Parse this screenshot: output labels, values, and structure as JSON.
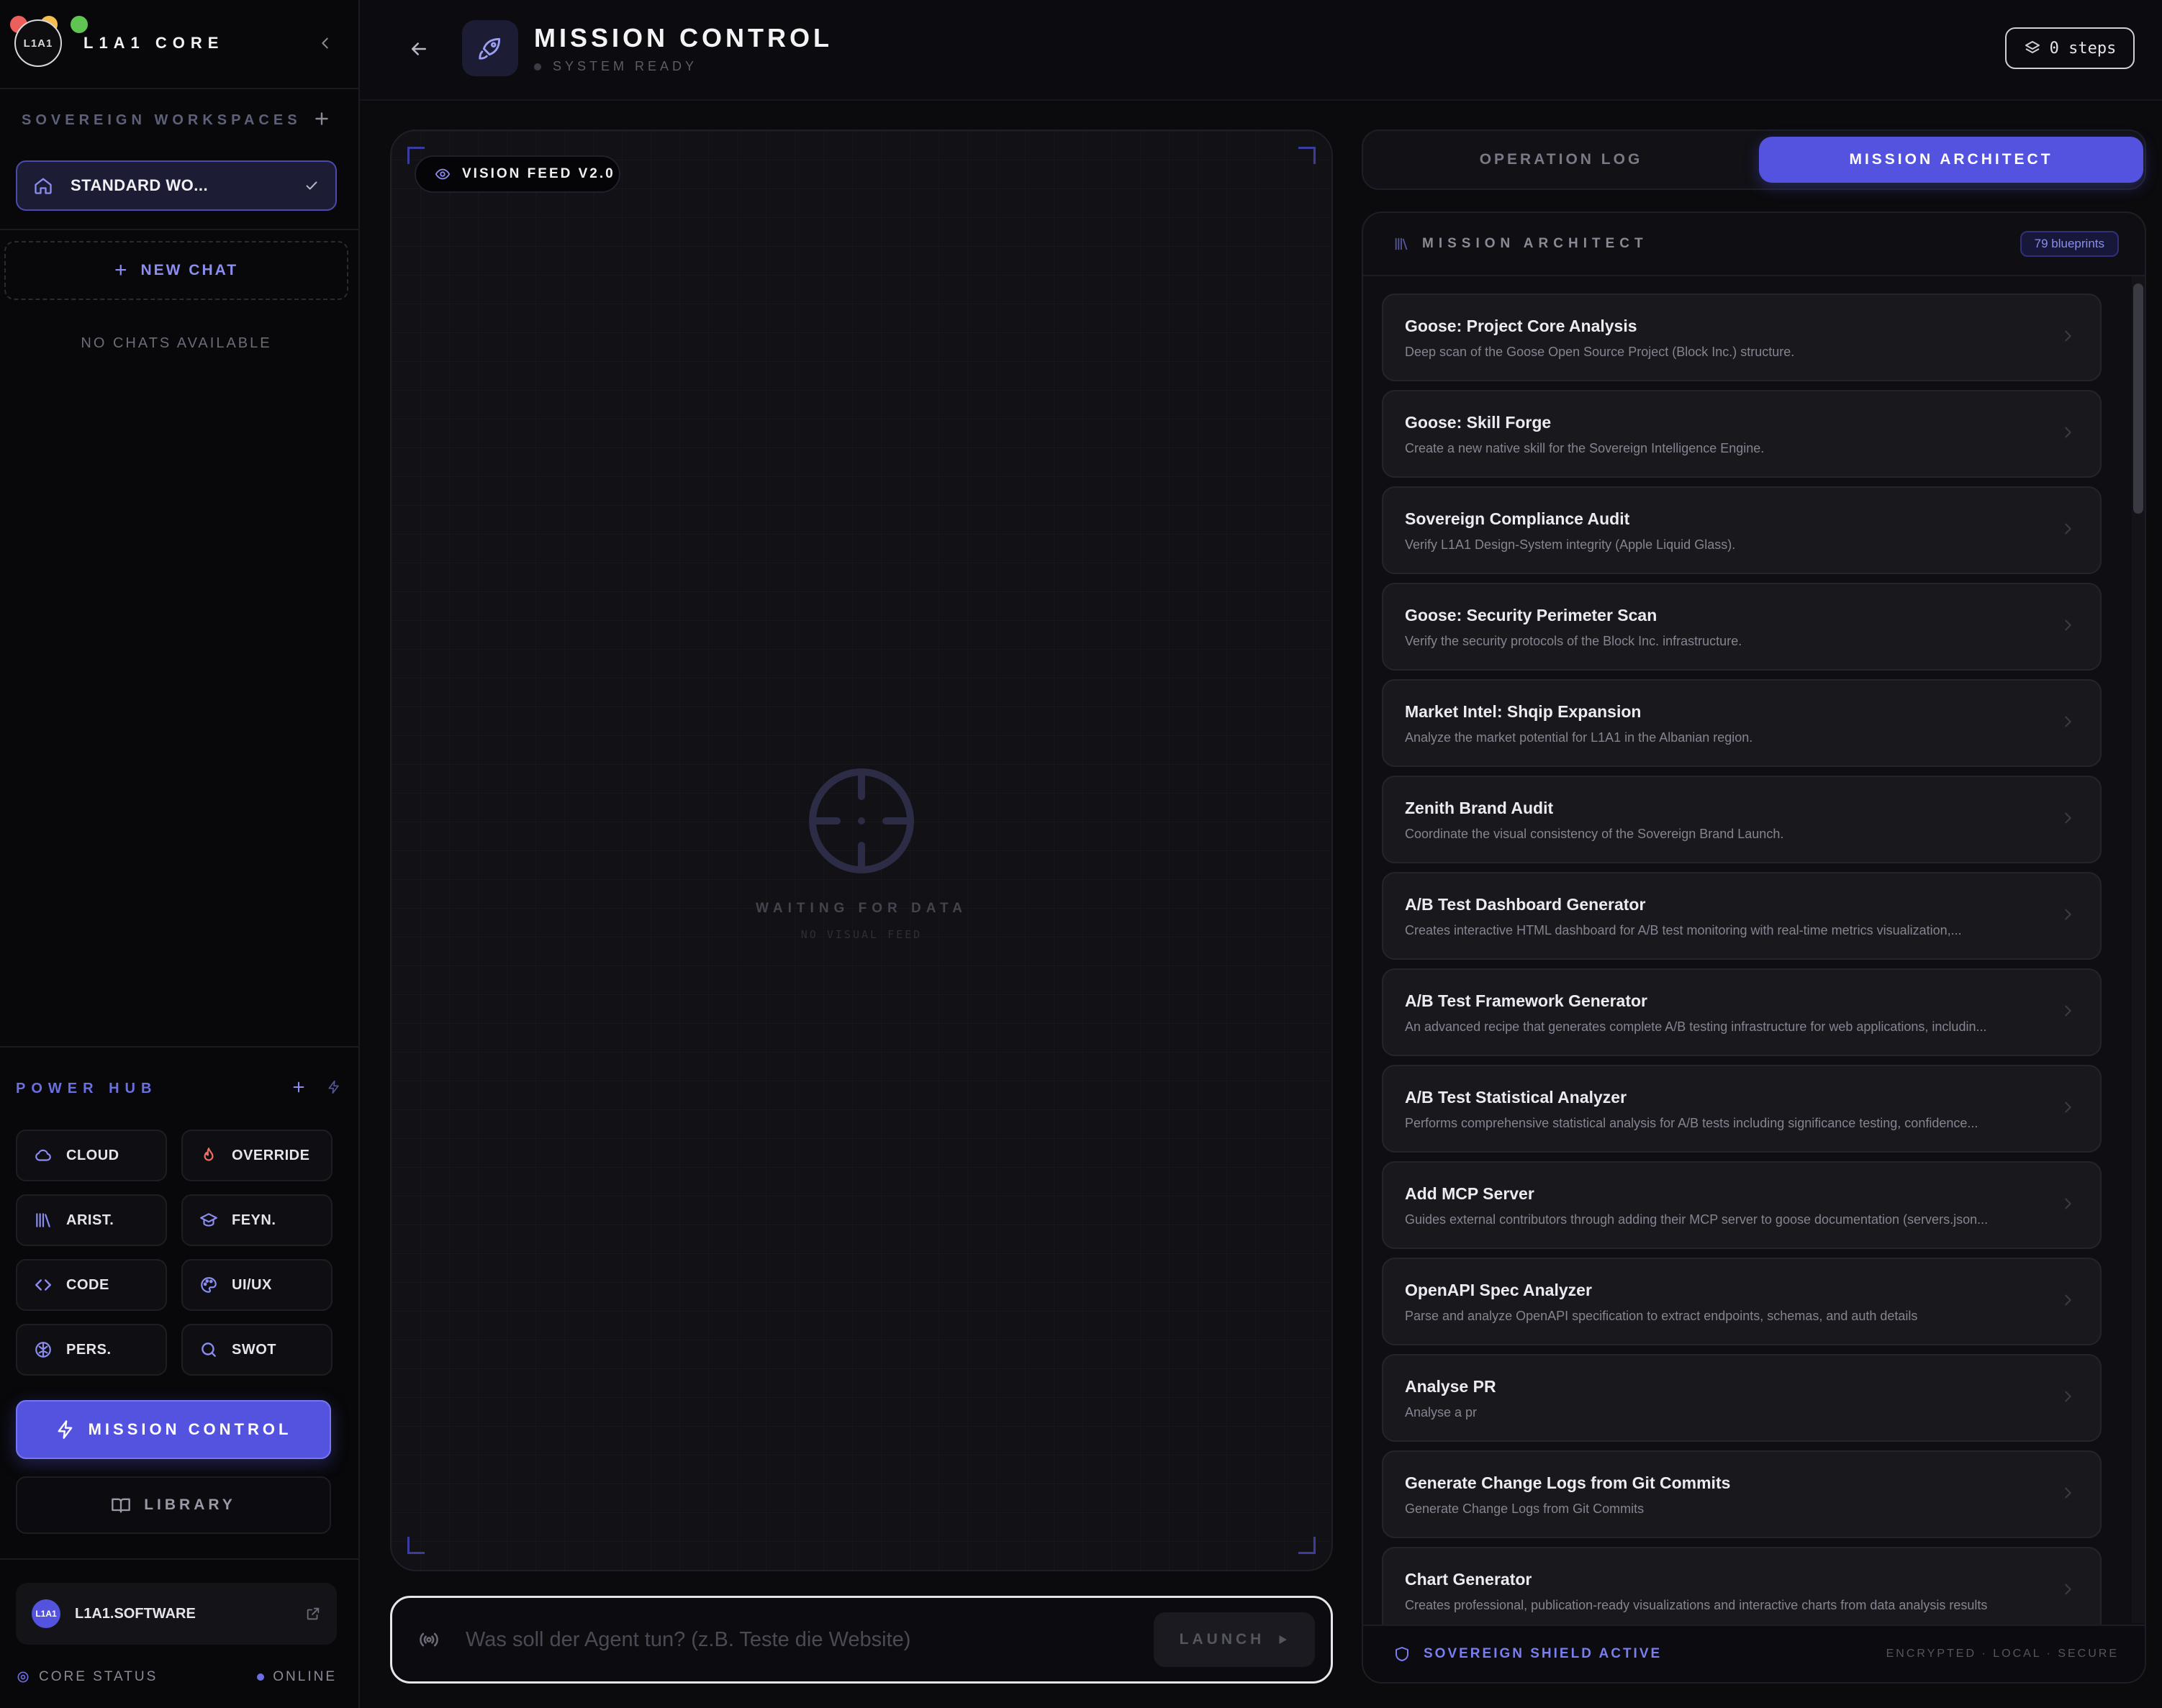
{
  "window": {
    "traffic_lights": [
      "#ec5f5a",
      "#f4be4f",
      "#5fc452"
    ]
  },
  "sidebar": {
    "brand": {
      "logo_text": "L1A1",
      "name": "L1A1 CORE"
    },
    "workspaces": {
      "title": "SOVEREIGN WORKSPACES",
      "active": "STANDARD WO..."
    },
    "new_chat": "NEW CHAT",
    "no_chats": "NO CHATS AVAILABLE",
    "power_hub": {
      "title": "POWER HUB",
      "items": [
        {
          "label": "CLOUD",
          "icon": "cloud-icon"
        },
        {
          "label": "OVERRIDE",
          "icon": "flame-icon"
        },
        {
          "label": "ARIST.",
          "icon": "library-icon"
        },
        {
          "label": "FEYN.",
          "icon": "graduation-cap-icon"
        },
        {
          "label": "CODE",
          "icon": "code-icon"
        },
        {
          "label": "UI/UX",
          "icon": "palette-icon"
        },
        {
          "label": "PERS.",
          "icon": "brain-icon"
        },
        {
          "label": "SWOT",
          "icon": "search-icon"
        }
      ]
    },
    "mission_control": "MISSION CONTROL",
    "library": "LIBRARY",
    "account": {
      "logo_text": "L1A1",
      "name": "L1A1.SOFTWARE"
    },
    "core_status": {
      "label": "CORE STATUS",
      "value": "ONLINE"
    }
  },
  "header": {
    "title": "MISSION CONTROL",
    "subtitle": "SYSTEM READY",
    "steps": "0 steps"
  },
  "vision": {
    "badge": "VISION FEED V2.0",
    "waiting": "WAITING FOR DATA",
    "no_feed": "NO VISUAL FEED"
  },
  "command": {
    "placeholder": "Was soll der Agent tun? (z.B. Teste die Website)",
    "launch": "LAUNCH"
  },
  "tabs": {
    "log": "OPERATION LOG",
    "architect": "MISSION ARCHITECT"
  },
  "architect": {
    "title": "MISSION ARCHITECT",
    "count": "79 blueprints",
    "blueprints": [
      {
        "title": "Goose: Project Core Analysis",
        "desc": "Deep scan of the Goose Open Source Project (Block Inc.) structure."
      },
      {
        "title": "Goose: Skill Forge",
        "desc": "Create a new native skill for the Sovereign Intelligence Engine."
      },
      {
        "title": "Sovereign Compliance Audit",
        "desc": "Verify L1A1 Design-System integrity (Apple Liquid Glass)."
      },
      {
        "title": "Goose: Security Perimeter Scan",
        "desc": "Verify the security protocols of the Block Inc. infrastructure."
      },
      {
        "title": "Market Intel: Shqip Expansion",
        "desc": "Analyze the market potential for L1A1 in the Albanian region."
      },
      {
        "title": "Zenith Brand Audit",
        "desc": "Coordinate the visual consistency of the Sovereign Brand Launch."
      },
      {
        "title": "A/B Test Dashboard Generator",
        "desc": "Creates interactive HTML dashboard for A/B test monitoring with real-time metrics visualization,..."
      },
      {
        "title": "A/B Test Framework Generator",
        "desc": "An advanced recipe that generates complete A/B testing infrastructure for web applications, includin..."
      },
      {
        "title": "A/B Test Statistical Analyzer",
        "desc": "Performs comprehensive statistical analysis for A/B tests including significance testing, confidence..."
      },
      {
        "title": "Add MCP Server",
        "desc": "Guides external contributors through adding their MCP server to goose documentation (servers.json..."
      },
      {
        "title": "OpenAPI Spec Analyzer",
        "desc": "Parse and analyze OpenAPI specification to extract endpoints, schemas, and auth details"
      },
      {
        "title": "Analyse PR",
        "desc": "Analyse a pr"
      },
      {
        "title": "Generate Change Logs from Git Commits",
        "desc": "Generate Change Logs from Git Commits"
      },
      {
        "title": "Chart Generator",
        "desc": "Creates professional, publication-ready visualizations and interactive charts from data analysis results"
      }
    ],
    "footer": {
      "shield": "SOVEREIGN SHIELD ACTIVE",
      "right": "ENCRYPTED · LOCAL · SECURE"
    }
  },
  "colors": {
    "accent": "#5453e0",
    "accent_text": "#8b8df0",
    "background": "#0b0b0e",
    "panel": "#111116"
  }
}
